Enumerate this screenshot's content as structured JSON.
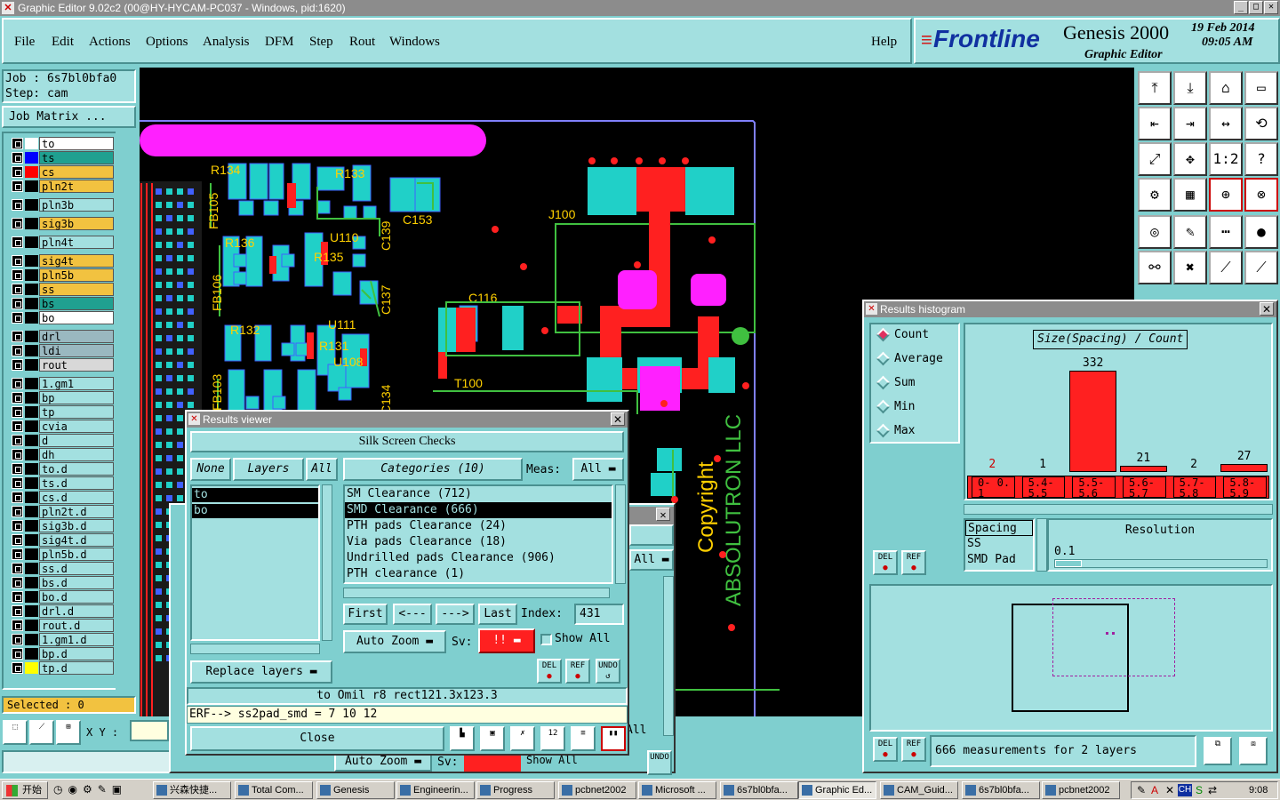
{
  "window": {
    "title": "Graphic Editor 9.02c2 (00@HY-HYCAM-PC037 - Windows, pid:1620)"
  },
  "menu": [
    "File",
    "Edit",
    "Actions",
    "Options",
    "Analysis",
    "DFM",
    "Step",
    "Rout",
    "Windows"
  ],
  "help": "Help",
  "logo": {
    "brand": "Frontline",
    "product": "Genesis 2000",
    "subtitle": "Graphic Editor",
    "date": "19 Feb 2014",
    "time": "09:05 AM"
  },
  "job": {
    "job_label": "Job : 6s7bl0bfa0",
    "step_label": "Step: cam",
    "matrix_button": "Job Matrix ..."
  },
  "layers": [
    {
      "name": "to",
      "color": "#ffffff",
      "bg": "#ffffff",
      "mark": "#0000cc"
    },
    {
      "name": "ts",
      "color": "#0000ff",
      "bg": "#20a090"
    },
    {
      "name": "cs",
      "color": "#ff0000",
      "bg": "#f2c240"
    },
    {
      "name": "pln2t",
      "color": "#000000",
      "bg": "#f2c240"
    },
    {
      "name": "pln3b",
      "color": "#000000",
      "bg": "#a3e0e0"
    },
    {
      "name": "sig3b",
      "color": "#000000",
      "bg": "#f2c240"
    },
    {
      "name": "pln4t",
      "color": "#000000",
      "bg": "#a3e0e0"
    },
    {
      "name": "sig4t",
      "color": "#000000",
      "bg": "#f2c240"
    },
    {
      "name": "pln5b",
      "color": "#000000",
      "bg": "#f2c240"
    },
    {
      "name": "ss",
      "color": "#000000",
      "bg": "#f2c240"
    },
    {
      "name": "bs",
      "color": "#000000",
      "bg": "#20a090"
    },
    {
      "name": "bo",
      "color": "#000000",
      "bg": "#ffffff"
    },
    {
      "name": "drl",
      "color": "#000000",
      "bg": "#9ab8c0"
    },
    {
      "name": "ldi",
      "color": "#000000",
      "bg": "#9ab8c0"
    },
    {
      "name": "rout",
      "color": "#000000",
      "bg": "#d8d8d8"
    },
    {
      "name": "1.gm1",
      "color": "#000000",
      "bg": "#a3e0e0"
    },
    {
      "name": "bp",
      "color": "#000000",
      "bg": "#a3e0e0"
    },
    {
      "name": "tp",
      "color": "#000000",
      "bg": "#a3e0e0"
    },
    {
      "name": "cvia",
      "color": "#000000",
      "bg": "#a3e0e0"
    },
    {
      "name": "d",
      "color": "#000000",
      "bg": "#a3e0e0"
    },
    {
      "name": "dh",
      "color": "#000000",
      "bg": "#a3e0e0"
    },
    {
      "name": "to.d",
      "color": "#000000",
      "bg": "#a3e0e0"
    },
    {
      "name": "ts.d",
      "color": "#000000",
      "bg": "#a3e0e0"
    },
    {
      "name": "cs.d",
      "color": "#000000",
      "bg": "#a3e0e0"
    },
    {
      "name": "pln2t.d",
      "color": "#000000",
      "bg": "#a3e0e0"
    },
    {
      "name": "sig3b.d",
      "color": "#000000",
      "bg": "#a3e0e0"
    },
    {
      "name": "sig4t.d",
      "color": "#000000",
      "bg": "#a3e0e0"
    },
    {
      "name": "pln5b.d",
      "color": "#000000",
      "bg": "#a3e0e0"
    },
    {
      "name": "ss.d",
      "color": "#000000",
      "bg": "#a3e0e0"
    },
    {
      "name": "bs.d",
      "color": "#000000",
      "bg": "#a3e0e0"
    },
    {
      "name": "bo.d",
      "color": "#000000",
      "bg": "#a3e0e0"
    },
    {
      "name": "drl.d",
      "color": "#000000",
      "bg": "#a3e0e0"
    },
    {
      "name": "rout.d",
      "color": "#000000",
      "bg": "#a3e0e0"
    },
    {
      "name": "1.gm1.d",
      "color": "#000000",
      "bg": "#a3e0e0"
    },
    {
      "name": "bp.d",
      "color": "#000000",
      "bg": "#a3e0e0"
    },
    {
      "name": "tp.d",
      "color": "#ffff00",
      "bg": "#a3e0e0"
    }
  ],
  "selected_label": "Selected : 0",
  "xy_label": "X Y :",
  "pcb_labels": [
    "R134",
    "R133",
    "FB105",
    "C153",
    "J100",
    "R136",
    "U110",
    "C139",
    "R135",
    "FB106",
    "C137",
    "C116",
    "R132",
    "U111",
    "R131",
    "U108",
    "FB103",
    "T100",
    "C134",
    "Copyright",
    "ABSOLUTRON LLC"
  ],
  "results_viewer": {
    "title": "Results viewer",
    "header": "Silk Screen Checks",
    "none_btn": "None",
    "layers_btn": "Layers",
    "all_btn": "All",
    "categories_btn": "Categories (10)",
    "meas_label": "Meas:",
    "meas_value": "All",
    "layer_list": [
      "to",
      "bo"
    ],
    "categories": [
      "SM Clearance (712)",
      "SMD Clearance (666)",
      "PTH pads Clearance (24)",
      "Via pads Clearance (18)",
      "Undrilled pads Clearance (906)",
      "PTH clearance (1)"
    ],
    "first": "First",
    "prev": "<---",
    "next": "--->",
    "last": "Last",
    "index_label": "Index:",
    "index_value": "431",
    "auto_zoom": "Auto Zoom",
    "sv_label": "Sv:",
    "sv_value": "!!",
    "show_all": "Show All",
    "replace_layers": "Replace layers",
    "del": "DEL",
    "ref": "REF",
    "undo": "UNDO",
    "info_line": "to Omil  r8  rect121.3x123.3",
    "erf_line": "ERF--> ss2pad_smd = 7 10 12",
    "close": "Close"
  },
  "back_window": {
    "all_label": "All",
    "auto_zoom": "Auto Zoom",
    "sv_label": "Sv:",
    "show_all": "Show All",
    "undo": "UNDO"
  },
  "histogram": {
    "title": "Results histogram",
    "options": [
      "Count",
      "Average",
      "Sum",
      "Min",
      "Max"
    ],
    "selected_option": "Count",
    "chart_title": "Size(Spacing) / Count",
    "del": "DEL",
    "ref": "REF",
    "measure_list": [
      "Spacing",
      "SS",
      "SMD Pad"
    ],
    "resolution_label": "Resolution",
    "resolution_value": "0.1",
    "status": "666 measurements for 2 layers"
  },
  "chart_data": {
    "type": "bar",
    "title": "Size(Spacing) / Count",
    "categories": [
      "0- 0.1",
      "5.4- 5.5",
      "5.5- 5.6",
      "5.6- 5.7",
      "5.7- 5.8",
      "5.8- 5.9"
    ],
    "values": [
      2,
      1,
      332,
      21,
      2,
      27
    ],
    "ylim": [
      0,
      332
    ]
  },
  "taskbar": {
    "start": "开始",
    "tasks": [
      "兴森快捷...",
      "Total Com...",
      "Genesis",
      "Engineerin...",
      "Progress",
      "pcbnet2002",
      "Microsoft ...",
      "6s7bl0bfa...",
      "Graphic Ed...",
      "CAM_Guid...",
      "6s7bl0bfa...",
      "pcbnet2002"
    ],
    "active_task": 8,
    "clock": "9:08",
    "tray": [
      "CH"
    ]
  }
}
